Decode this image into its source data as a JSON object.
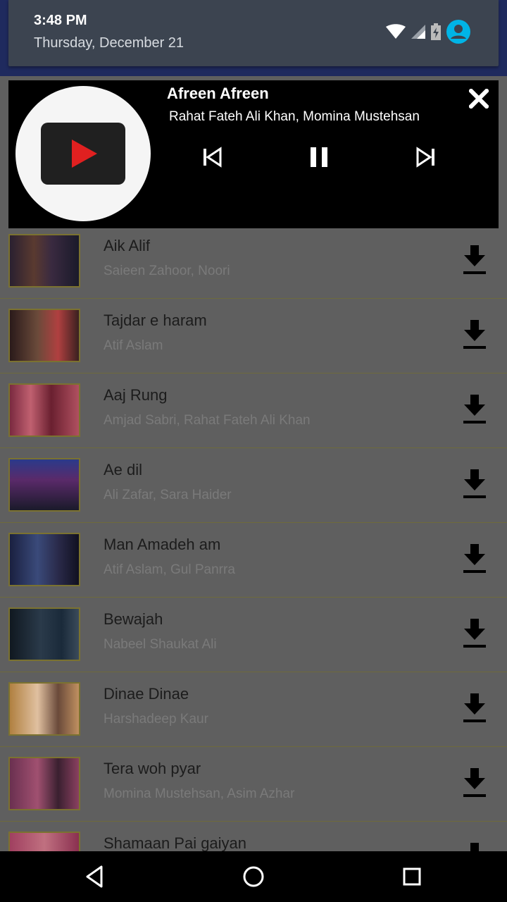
{
  "status_bar": {
    "time": "3:48 PM",
    "date": "Thursday, December 21",
    "icons": [
      "wifi-icon",
      "signal-icon",
      "battery-charging-icon",
      "account-icon"
    ]
  },
  "player": {
    "title": "Afreen Afreen",
    "artist": "Rahat Fateh Ali Khan, Momina Mustehsan",
    "icons": [
      "youtube-logo-icon",
      "close-icon",
      "previous-icon",
      "pause-icon",
      "next-icon"
    ]
  },
  "songs": [
    {
      "title": "Aik Alif",
      "artist": "Saieen Zahoor, Noori"
    },
    {
      "title": "Tajdar e haram",
      "artist": "Atif Aslam"
    },
    {
      "title": "Aaj Rung",
      "artist": "Amjad Sabri,  Rahat Fateh Ali Khan"
    },
    {
      "title": "Ae dil",
      "artist": "Ali Zafar, Sara Haider"
    },
    {
      "title": "Man Amadeh am",
      "artist": "Atif Aslam, Gul Panrra"
    },
    {
      "title": "Bewajah",
      "artist": "Nabeel Shaukat Ali"
    },
    {
      "title": "Dinae Dinae",
      "artist": "Harshadeep Kaur"
    },
    {
      "title": "Tera woh pyar",
      "artist": "Momina Mustehsan, Asim Azhar"
    },
    {
      "title": "Shamaan Pai gaiyan",
      "artist": ""
    }
  ],
  "nav": {
    "icons": [
      "back-icon",
      "home-icon",
      "recents-icon"
    ]
  },
  "colors": {
    "shade": "#3c4450",
    "player_bg": "#000000",
    "list_bg": "#5f5f5f",
    "accent_red": "#e02020"
  }
}
